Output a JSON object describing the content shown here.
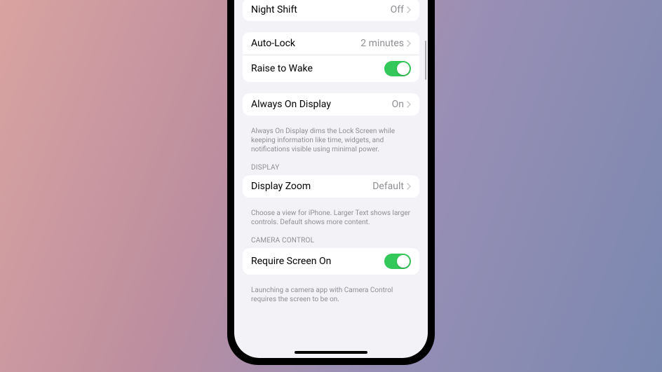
{
  "nightShift": {
    "label": "Night Shift",
    "value": "Off"
  },
  "autoLock": {
    "label": "Auto-Lock",
    "value": "2 minutes"
  },
  "raiseToWake": {
    "label": "Raise to Wake",
    "on": true
  },
  "alwaysOn": {
    "label": "Always On Display",
    "value": "On",
    "footer": "Always On Display dims the Lock Screen while keeping information like time, widgets, and notifications visible using minimal power."
  },
  "displaySection": {
    "header": "DISPLAY",
    "displayZoom": {
      "label": "Display Zoom",
      "value": "Default"
    },
    "footer": "Choose a view for iPhone. Larger Text shows larger controls. Default shows more content."
  },
  "cameraSection": {
    "header": "CAMERA CONTROL",
    "requireScreenOn": {
      "label": "Require Screen On",
      "on": true
    },
    "footer": "Launching a camera app with Camera Control requires the screen to be on."
  }
}
